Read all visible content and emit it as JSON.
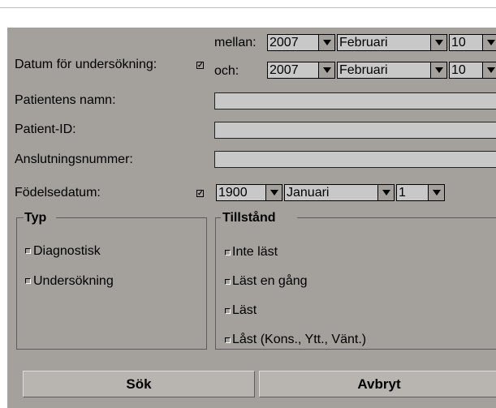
{
  "form": {
    "exam_date_label": "Datum för undersökning:",
    "exam_date_checked": true,
    "between_label": "mellan:",
    "and_label": "och:",
    "from": {
      "year": "2007",
      "month": "Februari",
      "day": "10"
    },
    "to": {
      "year": "2007",
      "month": "Februari",
      "day": "10"
    },
    "patient_name_label": "Patientens namn:",
    "patient_name_value": "",
    "patient_id_label": "Patient-ID:",
    "patient_id_value": "",
    "accession_label": "Anslutningsnummer:",
    "accession_value": "",
    "birth_date_label": "Födelsedatum:",
    "birth_date_checked": true,
    "birth": {
      "year": "1900",
      "month": "Januari",
      "day": "1"
    }
  },
  "type_group": {
    "title": "Typ",
    "items": [
      {
        "label": "Diagnostisk",
        "checked": false
      },
      {
        "label": "Undersökning",
        "checked": false
      }
    ]
  },
  "status_group": {
    "title": "Tillstånd",
    "items": [
      {
        "label": "Inte läst",
        "checked": false
      },
      {
        "label": "Läst en gång",
        "checked": false
      },
      {
        "label": "Läst",
        "checked": false
      },
      {
        "label": "Låst (Kons., Ytt., Vänt.)",
        "checked": false
      }
    ]
  },
  "buttons": {
    "search": "Sök",
    "cancel": "Avbryt"
  },
  "icons": {
    "dropdown": "triangle-down-icon",
    "check": "checkmark-icon"
  },
  "colors": {
    "panel": "#a4a09c",
    "field": "#c8c8c8",
    "button": "#b8b4b0"
  }
}
